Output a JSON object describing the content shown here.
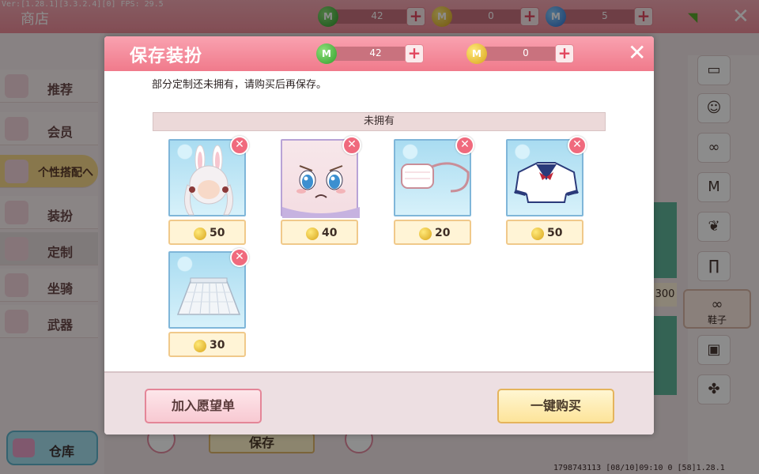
{
  "debug": "Ver:[1.28.1][3.3.2.4][0] FPS: 29.5",
  "shop": {
    "title": "商店",
    "currencies": [
      {
        "name": "green",
        "icon": "green-gem-icon",
        "value": "42"
      },
      {
        "name": "gold",
        "icon": "gold-coin-icon",
        "value": "0"
      },
      {
        "name": "blue",
        "icon": "blue-gem-icon",
        "value": "5"
      }
    ],
    "nav": [
      {
        "label": "推荐",
        "icon": "recommend-icon"
      },
      {
        "label": "会员",
        "icon": "vip-icon"
      },
      {
        "label": "个性搭配へ",
        "icon": "style-icon"
      },
      {
        "label": "装扮",
        "icon": "outfit-icon"
      },
      {
        "label": "定制",
        "icon": "custom-icon"
      },
      {
        "label": "坐骑",
        "icon": "mount-icon"
      },
      {
        "label": "武器",
        "icon": "weapon-icon"
      }
    ],
    "store_label": "仓库",
    "save_label": "保存",
    "categories_selected": "鞋子",
    "price_label": "300",
    "footer_id": "1798743113    [08/10]09:10 0    [58]1.28.1"
  },
  "dialog": {
    "title": "保存装扮",
    "currencies": [
      {
        "name": "green",
        "icon": "green-gem-icon",
        "value": "42"
      },
      {
        "name": "gold",
        "icon": "gold-coin-icon",
        "value": "0"
      }
    ],
    "message": "部分定制还未拥有，请购买后再保存。",
    "section_title": "未拥有",
    "items": [
      {
        "name": "bunny-hair",
        "price": "50"
      },
      {
        "name": "crying-face",
        "price": "40"
      },
      {
        "name": "face-mask",
        "price": "20"
      },
      {
        "name": "sailor-top",
        "price": "50"
      },
      {
        "name": "plaid-skirt",
        "price": "30"
      }
    ],
    "wishlist_label": "加入愿望单",
    "buy_all_label": "一键购买"
  }
}
